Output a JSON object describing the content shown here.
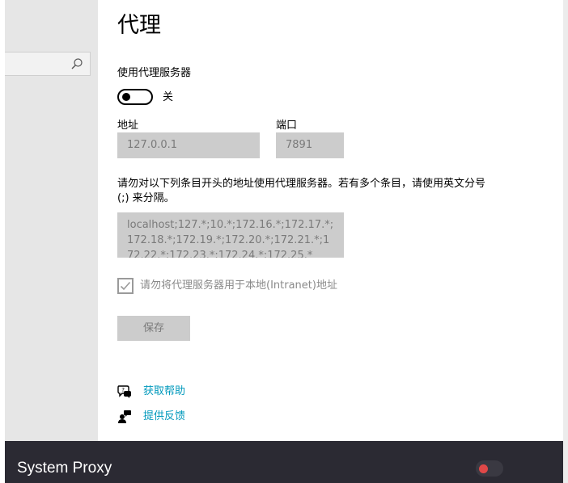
{
  "page": {
    "title": "代理",
    "use_proxy_label": "使用代理服务器",
    "toggle_state": "关",
    "address_label": "地址",
    "address_value": "127.0.0.1",
    "port_label": "端口",
    "port_value": "7891",
    "description": "请勿对以下列条目开头的地址使用代理服务器。若有多个条目，请使用英文分号 (;) 来分隔。",
    "exceptions_value": "localhost;127.*;10.*;172.16.*;172.17.*;172.18.*;172.19.*;172.20.*;172.21.*;172.22.*;172.23.*;172.24.*;172.25.*",
    "local_bypass_label": "请勿将代理服务器用于本地(Intranet)地址",
    "local_bypass_checked": true,
    "save_label": "保存",
    "toggle_on": false
  },
  "links": {
    "help": "获取帮助",
    "feedback": "提供反馈",
    "color": "#0099bc"
  },
  "search": {
    "icon": "search-icon"
  },
  "bottom_bar": {
    "title": "System Proxy",
    "toggle_color": "#e04848"
  }
}
